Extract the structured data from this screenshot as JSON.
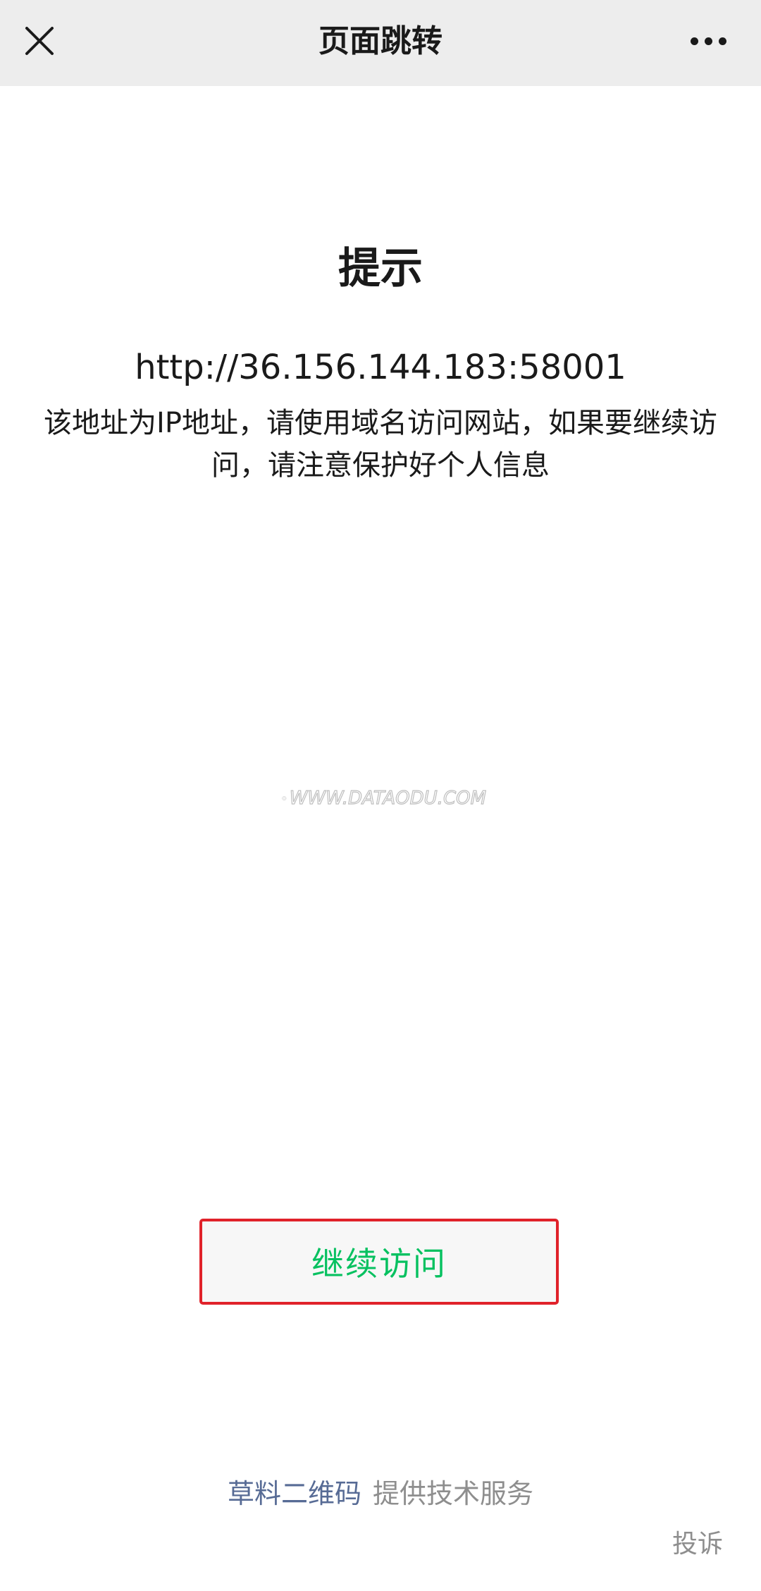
{
  "navbar": {
    "title": "页面跳转",
    "close_icon": "close-icon",
    "more_icon": "more-dots-icon"
  },
  "notice": {
    "title": "提示",
    "url": "http://36.156.144.183:58001",
    "message": "该地址为IP地址，请使用域名访问网站，如果要继续访问，请注意保护好个人信息"
  },
  "watermark": {
    "text": "WWW.DATAODU.COM"
  },
  "actions": {
    "continue_label": "继续访问"
  },
  "footer": {
    "brand": "草料二维码",
    "service": "提供技术服务",
    "report": "投诉"
  },
  "colors": {
    "navbar_bg": "#ededed",
    "accent_green": "#07c160",
    "highlight_red": "#e0222a",
    "link_blue": "#576b95",
    "muted_gray": "#8e8e8e"
  }
}
